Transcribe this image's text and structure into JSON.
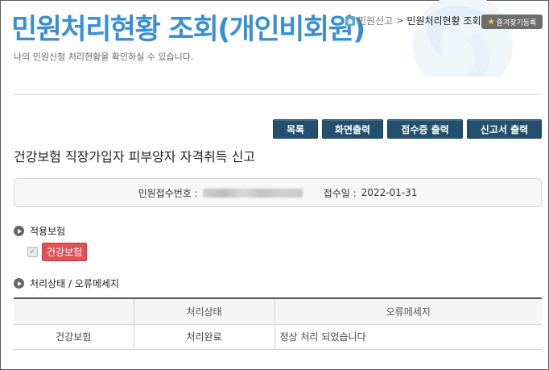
{
  "header": {
    "title": "민원처리현황 조회(개인비회원)",
    "subtitle": "나의 민원신청 처리현황을 확인하실 수 있습니다."
  },
  "breadcrumb": {
    "home_icon": "home-icon",
    "link": "민원신고",
    "separator": ">",
    "current": "민원처리현황 조회"
  },
  "favorites": {
    "icon": "star-icon",
    "label": "즐겨찾기등록"
  },
  "toolbar": {
    "list_label": "목록",
    "print_screen_label": "화면출력",
    "print_receipt_label": "접수증 출력",
    "print_report_label": "신고서 출력"
  },
  "document": {
    "title": "건강보험 직장가입자 피부양자 자격취득 신고"
  },
  "receipt": {
    "number_label": "민원접수번호 :",
    "number_value": "",
    "date_label": "접수일 :",
    "date_value": "2022-01-31"
  },
  "insurance_section": {
    "title": "적용보험",
    "badge": "건강보험"
  },
  "status_section": {
    "title": "처리상태 / 오류메세지",
    "columns": [
      "",
      "처리상태",
      "오류메세지"
    ],
    "rows": [
      {
        "insurance": "건강보험",
        "status": "처리완료",
        "message": "정상 처리 되었습니다"
      }
    ]
  },
  "colors": {
    "title_blue": "#3a8fd4",
    "button_navy": "#24506f",
    "badge_red": "#e05458",
    "status_brown": "#8a4513"
  }
}
